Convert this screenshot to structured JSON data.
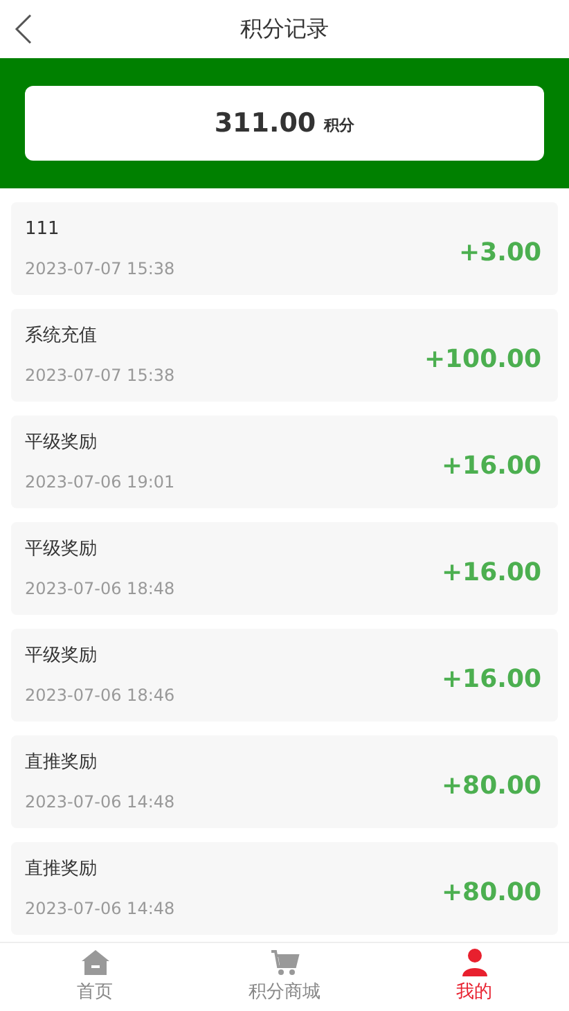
{
  "header": {
    "title": "积分记录"
  },
  "balance": {
    "amount": "311.00",
    "unit": "积分"
  },
  "records": [
    {
      "title": "111",
      "time": "2023-07-07 15:38",
      "points": "+3.00"
    },
    {
      "title": "系统充值",
      "time": "2023-07-07 15:38",
      "points": "+100.00"
    },
    {
      "title": "平级奖励",
      "time": "2023-07-06 19:01",
      "points": "+16.00"
    },
    {
      "title": "平级奖励",
      "time": "2023-07-06 18:48",
      "points": "+16.00"
    },
    {
      "title": "平级奖励",
      "time": "2023-07-06 18:46",
      "points": "+16.00"
    },
    {
      "title": "直推奖励",
      "time": "2023-07-06 14:48",
      "points": "+80.00"
    },
    {
      "title": "直推奖励",
      "time": "2023-07-06 14:48",
      "points": "+80.00"
    }
  ],
  "tab_bar": [
    {
      "label": "首页",
      "selected": false
    },
    {
      "label": "积分商城",
      "selected": false
    },
    {
      "label": "我的",
      "selected": true
    }
  ]
}
